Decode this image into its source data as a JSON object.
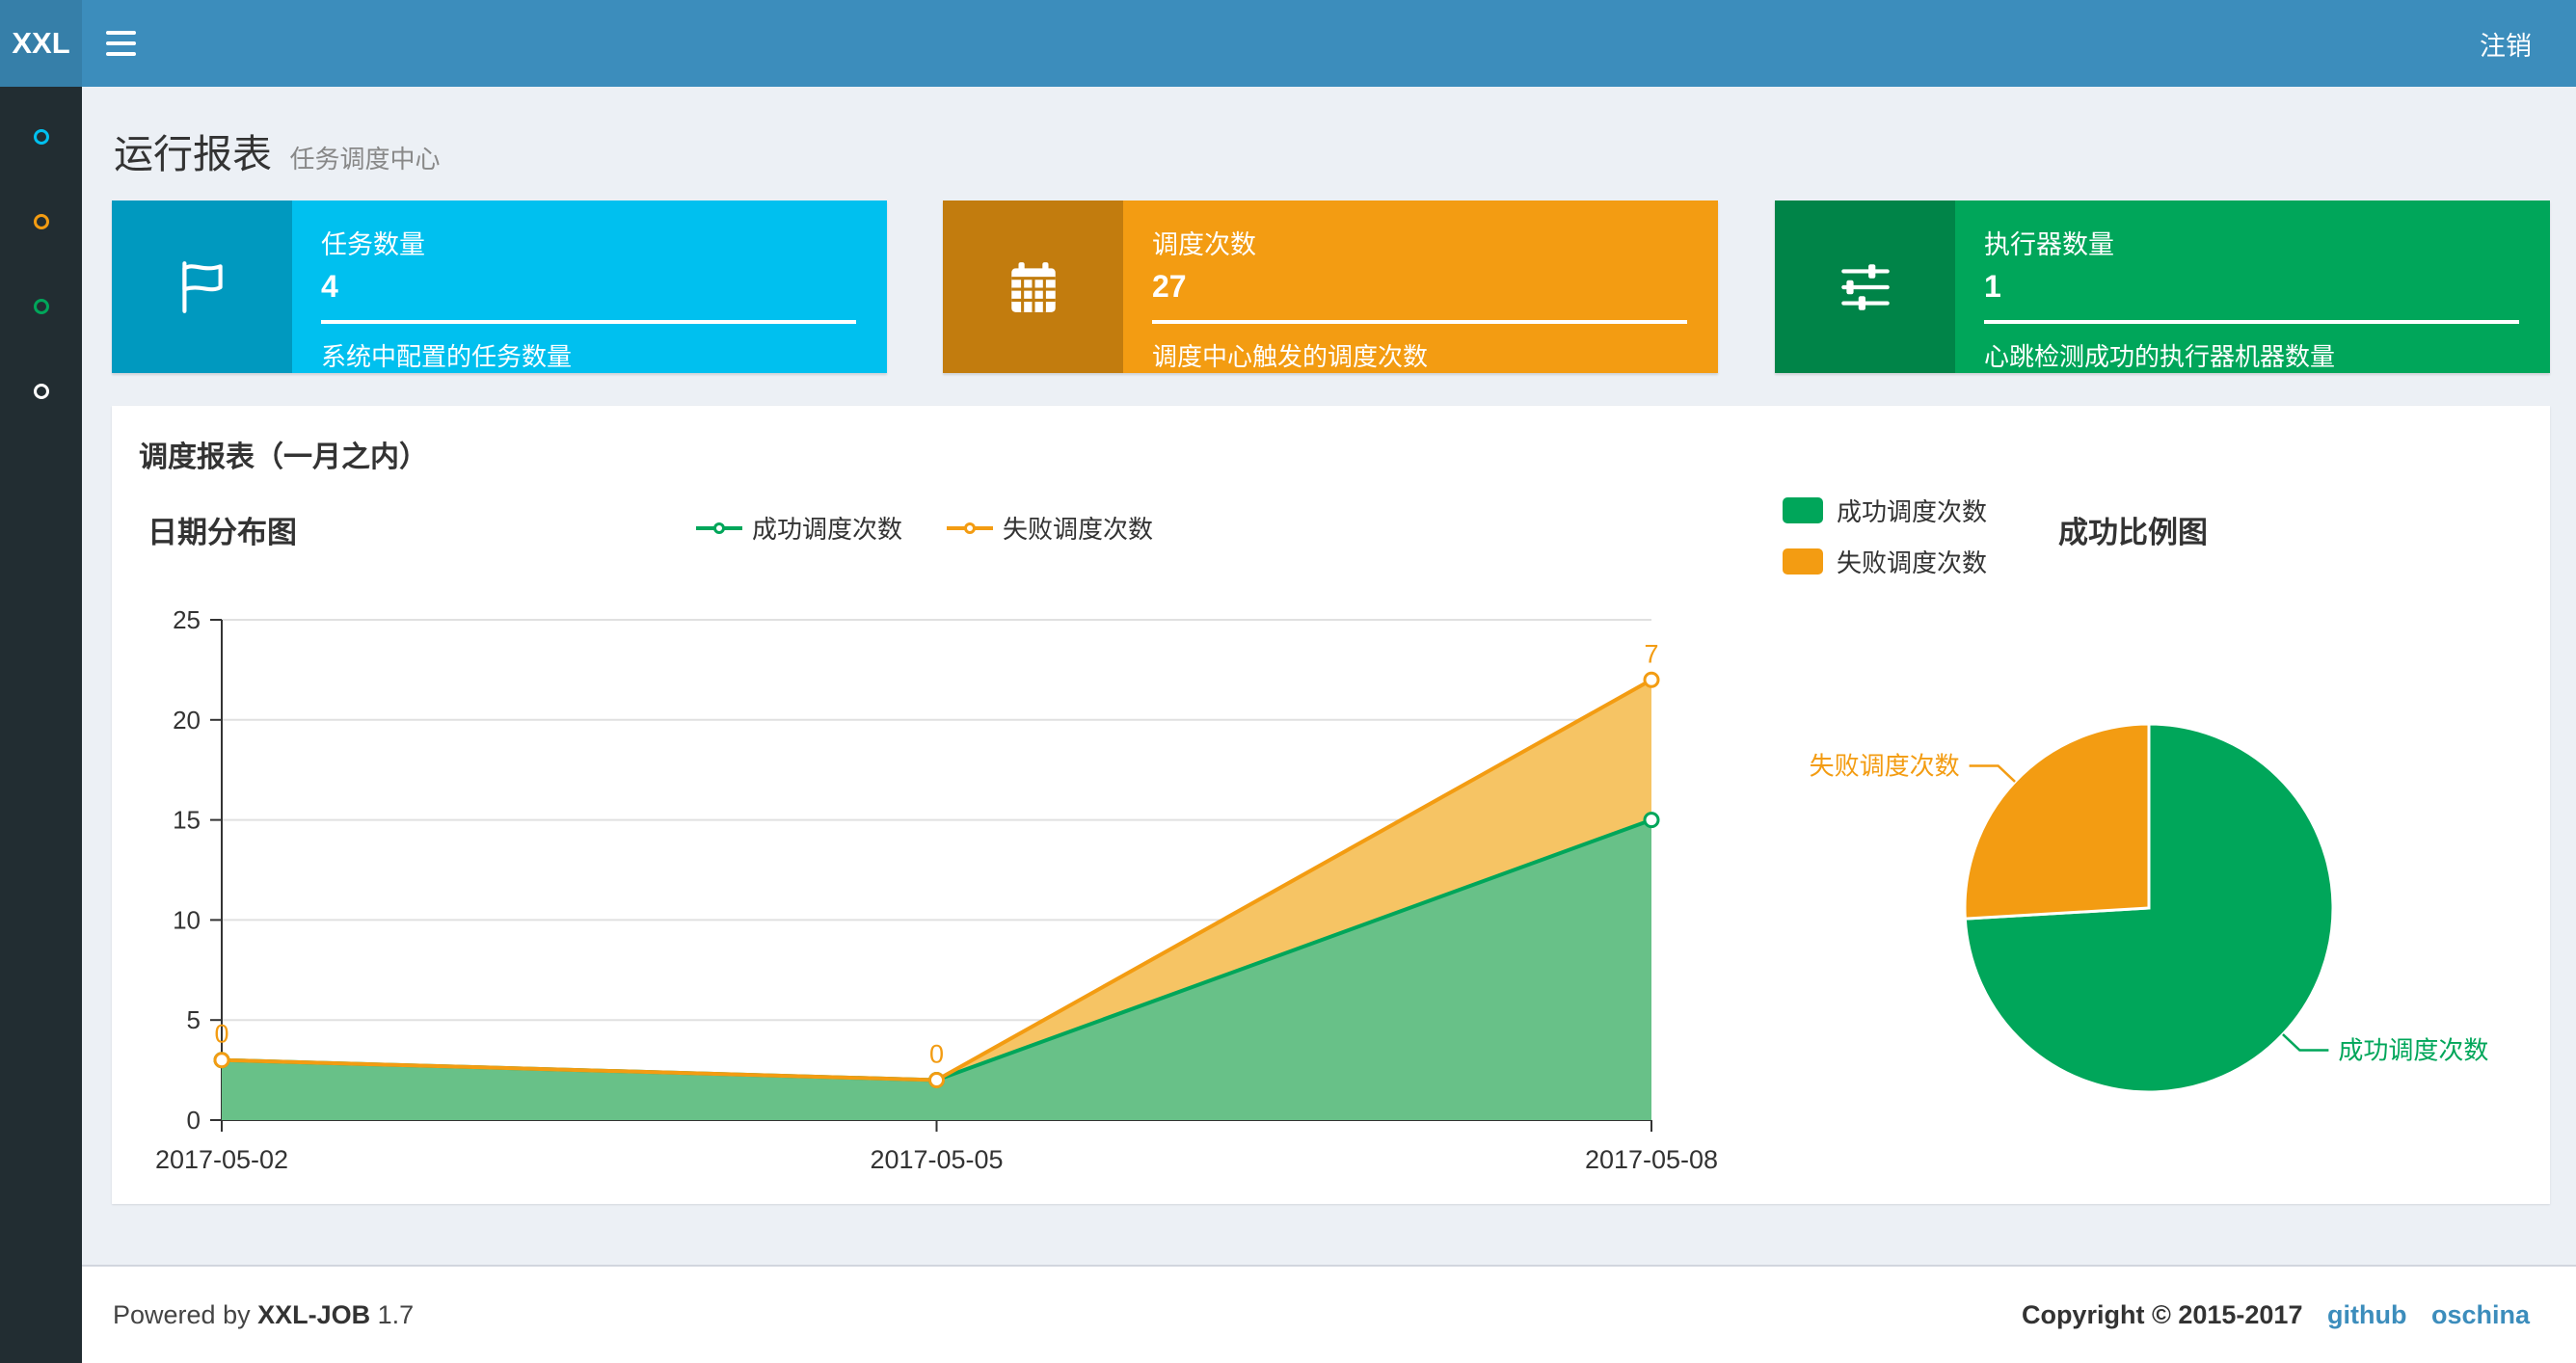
{
  "navbar": {
    "logo": "XXL",
    "logout": "注销"
  },
  "sidebar": {
    "items": [
      {
        "id": "run-report",
        "color": "#00c0ef"
      },
      {
        "id": "job-manage",
        "color": "#f39c12"
      },
      {
        "id": "dispatch-log",
        "color": "#00a65a"
      },
      {
        "id": "help",
        "color": "#ffffff"
      }
    ]
  },
  "page_header": {
    "title": "运行报表",
    "subtitle": "任务调度中心"
  },
  "info_boxes": [
    {
      "label": "任务数量",
      "value": "4",
      "desc": "系统中配置的任务数量",
      "bg": "#00c0ef",
      "icon": "flag-icon"
    },
    {
      "label": "调度次数",
      "value": "27",
      "desc": "调度中心触发的调度次数",
      "bg": "#f39c12",
      "icon": "calendar-icon"
    },
    {
      "label": "执行器数量",
      "value": "1",
      "desc": "心跳检测成功的执行器机器数量",
      "bg": "#00a65a",
      "icon": "sliders-icon"
    }
  ],
  "panel": {
    "title": "调度报表（一月之内）"
  },
  "chart_data": [
    {
      "type": "area",
      "title": "日期分布图",
      "x": [
        "2017-05-02",
        "2017-05-05",
        "2017-05-08"
      ],
      "stacked": true,
      "ylim": [
        0,
        25
      ],
      "yticks": [
        0,
        5,
        10,
        15,
        20,
        25
      ],
      "grid": true,
      "legend_position": "top",
      "series": [
        {
          "name": "成功调度次数",
          "values": [
            3,
            2,
            15
          ],
          "color": "#00a65a",
          "fill": "#68c188"
        },
        {
          "name": "失败调度次数",
          "values": [
            0,
            0,
            7
          ],
          "color": "#f39c12",
          "fill": "#f6c464"
        }
      ],
      "point_labels": {
        "series": "失败调度次数",
        "values": [
          0,
          0,
          7
        ]
      }
    },
    {
      "type": "pie",
      "title": "成功比例图",
      "legend_position": "top-left",
      "slices": [
        {
          "name": "成功调度次数",
          "value": 20,
          "color": "#00a65a"
        },
        {
          "name": "失败调度次数",
          "value": 7,
          "color": "#f39c12"
        }
      ]
    }
  ],
  "footer": {
    "powered_prefix": "Powered by",
    "brand": "XXL-JOB",
    "version": "1.7",
    "copyright": "Copyright © 2015-2017",
    "links": [
      {
        "label": "github"
      },
      {
        "label": "oschina"
      }
    ]
  }
}
